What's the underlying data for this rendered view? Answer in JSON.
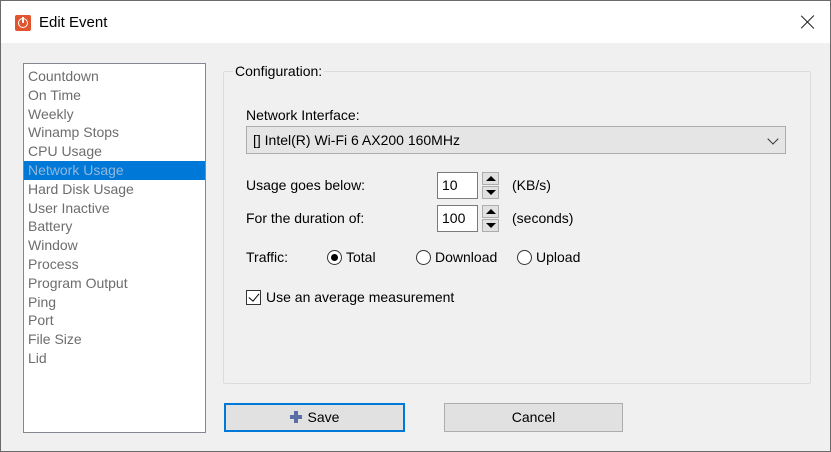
{
  "window": {
    "title": "Edit Event",
    "icon": "power-icon"
  },
  "event_types": [
    "Countdown",
    "On Time",
    "Weekly",
    "Winamp Stops",
    "CPU Usage",
    "Network Usage",
    "Hard Disk Usage",
    "User Inactive",
    "Battery",
    "Window",
    "Process",
    "Program Output",
    "Ping",
    "Port",
    "File Size",
    "Lid"
  ],
  "selected_event_type": "Network Usage",
  "configuration": {
    "group_label": "Configuration:",
    "network_interface_label": "Network Interface:",
    "network_interface_value": "[] Intel(R) Wi-Fi 6 AX200 160MHz",
    "usage_below_label": "Usage goes below:",
    "usage_below_value": "10",
    "usage_below_unit": "(KB/s)",
    "duration_label": "For the duration of:",
    "duration_value": "100",
    "duration_unit": "(seconds)",
    "traffic_label": "Traffic:",
    "traffic_options": [
      "Total",
      "Download",
      "Upload"
    ],
    "traffic_selected": "Total",
    "average_label": "Use an average measurement",
    "average_checked": true
  },
  "buttons": {
    "save": "Save",
    "cancel": "Cancel"
  },
  "colors": {
    "selection": "#0078d7",
    "app_icon": "#e0552d"
  }
}
